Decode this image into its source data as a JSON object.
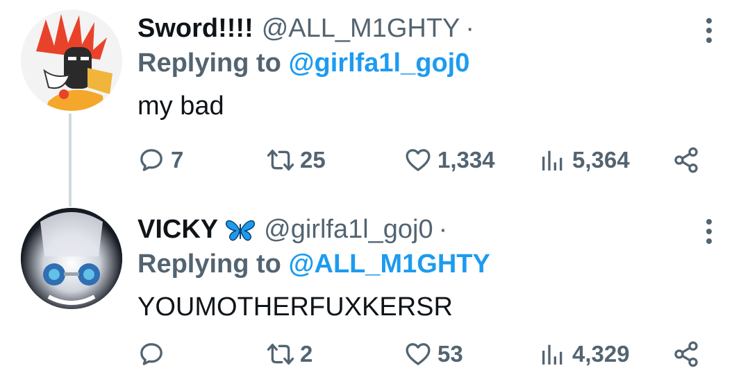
{
  "tweets": [
    {
      "name": "Sword!!!!",
      "handle": "@ALL_M1GHTY",
      "separator": "·",
      "replying_prefix": "Replying to",
      "replying_to": "@girlfa1l_goj0",
      "text": "my bad",
      "replies": "7",
      "retweets": "25",
      "likes": "1,334",
      "views": "5,364"
    },
    {
      "name": "VICKY",
      "name_emoji": "butterfly-icon",
      "handle": "@girlfa1l_goj0",
      "separator": "·",
      "replying_prefix": "Replying to",
      "replying_to": "@ALL_M1GHTY",
      "text": "YOUMOTHERFUXKERSR",
      "replies": "",
      "retweets": "2",
      "likes": "53",
      "views": "4,329"
    }
  ],
  "colors": {
    "text": "#0f1419",
    "secondary": "#536471",
    "link": "#1d9bf0",
    "thread_line": "#cfd9de"
  }
}
